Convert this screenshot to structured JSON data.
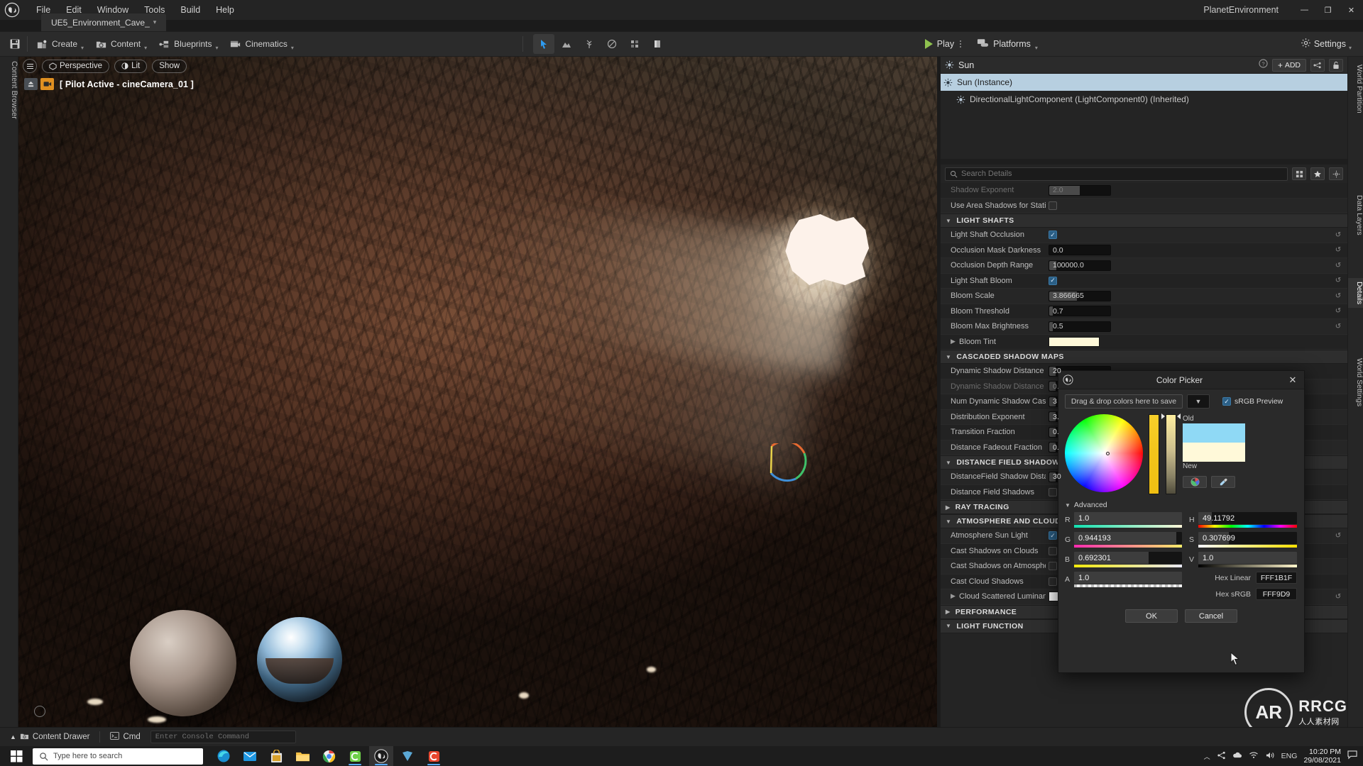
{
  "titlebar": {
    "logo_icon": "unreal-logo-icon",
    "menus": [
      "File",
      "Edit",
      "Window",
      "Tools",
      "Build",
      "Help"
    ],
    "project_name": "PlanetEnvironment",
    "window_buttons": [
      {
        "name": "minimize-button",
        "glyph": "—"
      },
      {
        "name": "maximize-button",
        "glyph": "❐"
      },
      {
        "name": "close-button",
        "glyph": "✕"
      }
    ]
  },
  "tabbar": {
    "document_tab": "UE5_Environment_Cave_",
    "modified_marker": "▾"
  },
  "toolbar": {
    "save_icon": "save-icon",
    "buttons": [
      {
        "label": "Create",
        "icon": "create-icon"
      },
      {
        "label": "Content",
        "icon": "content-icon"
      },
      {
        "label": "Blueprints",
        "icon": "blueprints-icon"
      },
      {
        "label": "Cinematics",
        "icon": "cinematics-icon"
      }
    ],
    "mode_icons": [
      "select-mode-icon",
      "landscape-mode-icon",
      "foliage-mode-icon",
      "mesh-paint-icon",
      "fracture-mode-icon",
      "brush-edit-icon"
    ],
    "play_label": "Play",
    "platforms_label": "Platforms",
    "settings_label": "Settings"
  },
  "viewport": {
    "hamburger_icon": "viewport-menu-icon",
    "camera_mode": "Perspective",
    "view_mode": "Lit",
    "show_label": "Show",
    "pilot_text": "[ Pilot Active - cineCamera_01 ]"
  },
  "left_strip": {
    "label": "Content Browser"
  },
  "outliner": {
    "title": "Sun",
    "help_icon": "help-icon",
    "add_label": "ADD",
    "settings_icon": "outliner-settings-icon",
    "lock_icon": "lock-icon",
    "rows": [
      {
        "label": "Sun (Instance)",
        "selected": true,
        "icon": "light-icon"
      },
      {
        "label": "DirectionalLightComponent (LightComponent0) (Inherited)",
        "selected": false,
        "icon": "light-icon"
      }
    ]
  },
  "details": {
    "search_placeholder": "Search Details",
    "grid_icon": "grid-view-icon",
    "star_icon": "favorites-icon",
    "gear_icon": "details-settings-icon",
    "rows": [
      {
        "type": "prop",
        "label": "Shadow Exponent",
        "value": "2.0",
        "control": "number",
        "fill": 0.5,
        "dim": true
      },
      {
        "type": "prop",
        "label": "Use Area Shadows for Stationary Lig",
        "control": "checkbox",
        "checked": false
      },
      {
        "type": "category",
        "label": "LIGHT SHAFTS",
        "expanded": true
      },
      {
        "type": "prop",
        "label": "Light Shaft Occlusion",
        "control": "checkbox",
        "checked": true,
        "reset": true
      },
      {
        "type": "prop",
        "label": "Occlusion Mask Darkness",
        "value": "0.0",
        "control": "number",
        "fill": 0.0,
        "reset": true
      },
      {
        "type": "prop",
        "label": "Occlusion Depth Range",
        "value": "100000.0",
        "control": "number",
        "fill": 0.12,
        "reset": true
      },
      {
        "type": "prop",
        "label": "Light Shaft Bloom",
        "control": "checkbox",
        "checked": true,
        "reset": true
      },
      {
        "type": "prop",
        "label": "Bloom Scale",
        "value": "3.866665",
        "control": "number",
        "fill": 0.45,
        "reset": true
      },
      {
        "type": "prop",
        "label": "Bloom Threshold",
        "value": "0.7",
        "control": "number",
        "fill": 0.06,
        "reset": true
      },
      {
        "type": "prop",
        "label": "Bloom Max Brightness",
        "value": "0.5",
        "control": "number",
        "fill": 0.06,
        "reset": true
      },
      {
        "type": "prop",
        "label": "Bloom Tint",
        "control": "swatch",
        "color": "#FFF9D9",
        "expandable": true
      },
      {
        "type": "category",
        "label": "CASCADED SHADOW MAPS",
        "expanded": true
      },
      {
        "type": "prop",
        "label": "Dynamic Shadow Distance Movable",
        "value": "20",
        "control": "number",
        "fill": 0.1
      },
      {
        "type": "prop",
        "label": "Dynamic Shadow Distance Stationar",
        "value": "0.",
        "control": "number",
        "fill": 0.1,
        "dim": true
      },
      {
        "type": "prop",
        "label": "Num Dynamic Shadow Cascades",
        "value": "3",
        "control": "number",
        "fill": 0.1
      },
      {
        "type": "prop",
        "label": "Distribution Exponent",
        "value": "3.",
        "control": "number",
        "fill": 0.1
      },
      {
        "type": "prop",
        "label": "Transition Fraction",
        "value": "0.",
        "control": "number",
        "fill": 0.1
      },
      {
        "type": "prop",
        "label": "Distance Fadeout Fraction",
        "value": "0.",
        "control": "number",
        "fill": 0.1
      },
      {
        "type": "category",
        "label": "DISTANCE FIELD SHADOWS",
        "expanded": true
      },
      {
        "type": "prop",
        "label": "DistanceField Shadow Distance",
        "value": "30",
        "control": "number",
        "fill": 0.1
      },
      {
        "type": "prop",
        "label": "Distance Field Shadows",
        "control": "checkbox",
        "checked": false
      },
      {
        "type": "category",
        "label": "RAY TRACING",
        "expanded": false
      },
      {
        "type": "category",
        "label": "ATMOSPHERE AND CLOUD",
        "expanded": true
      },
      {
        "type": "prop",
        "label": "Atmosphere Sun Light",
        "control": "checkbox",
        "checked": true,
        "reset": true
      },
      {
        "type": "prop",
        "label": "Cast Shadows on Clouds",
        "control": "checkbox",
        "checked": false
      },
      {
        "type": "prop",
        "label": "Cast Shadows on Atmosphere",
        "control": "checkbox",
        "checked": false
      },
      {
        "type": "prop",
        "label": "Cast Cloud Shadows",
        "control": "checkbox",
        "checked": false
      },
      {
        "type": "prop",
        "label": "Cloud Scattered Luminance Scale",
        "control": "swatch",
        "color": "#FFFFFF",
        "expandable": true,
        "reset": true
      },
      {
        "type": "category",
        "label": "PERFORMANCE",
        "expanded": false
      },
      {
        "type": "category",
        "label": "LIGHT FUNCTION",
        "expanded": true
      }
    ]
  },
  "right_tabs": [
    {
      "label": "World Partition",
      "active": false
    },
    {
      "label": "Data Layers",
      "active": false
    },
    {
      "label": "Details",
      "active": true
    },
    {
      "label": "World Settings",
      "active": false
    }
  ],
  "color_picker": {
    "title": "Color Picker",
    "logo_icon": "unreal-logo-icon",
    "close_icon": "close-icon",
    "dragdrop_label": "Drag & drop colors here to save",
    "dropdown_icon": "chevron-down-icon",
    "srgb_label": "sRGB Preview",
    "srgb_checked": true,
    "old_label": "Old",
    "new_label": "New",
    "old_color": "#8FD9F5",
    "new_color": "#FFF9D9",
    "wheel_icon": "color-wheel-icon",
    "eyedropper_icon": "eyedropper-icon",
    "advanced_label": "Advanced",
    "rgba": [
      {
        "key": "R",
        "value": "1.0",
        "fill": 1.0,
        "gradient": "linear-gradient(90deg,#11e0b0,#fdf6d8)"
      },
      {
        "key": "G",
        "value": "0.944193",
        "fill": 0.944,
        "gradient": "linear-gradient(90deg,#ff2bb0,#f6ec6a)"
      },
      {
        "key": "B",
        "value": "0.692301",
        "fill": 0.692,
        "gradient": "linear-gradient(90deg,#f2e90c,#e8e8f5)"
      },
      {
        "key": "A",
        "value": "1.0",
        "fill": 1.0,
        "gradient": "repeating-linear-gradient(90deg,#bdbdbd 0 4px,#f2f2f2 4px 8px)"
      }
    ],
    "hsv": [
      {
        "key": "H",
        "value": "49.11792",
        "fill": 0.135,
        "gradient": "linear-gradient(90deg,#ff0000,#ffff00,#00ff00,#00ffff,#0000ff,#ff00ff,#ff0000)"
      },
      {
        "key": "S",
        "value": "0.307699",
        "fill": 0.307,
        "gradient": "linear-gradient(90deg,#ffffff,#ffe000)"
      },
      {
        "key": "V",
        "value": "1.0",
        "fill": 1.0,
        "gradient": "linear-gradient(90deg,#000000,#fff6cc)"
      }
    ],
    "hex_linear_label": "Hex Linear",
    "hex_linear_value": "FFF1B1F",
    "hex_srgb_label": "Hex sRGB",
    "hex_srgb_value": "FFF9D9",
    "ok_label": "OK",
    "cancel_label": "Cancel"
  },
  "statusbar": {
    "chevron_icon": "chevron-up-icon",
    "content_drawer_label": "Content Drawer",
    "content_drawer_icon": "drawer-icon",
    "cmd_label": "Cmd",
    "cmd_icon": "console-icon",
    "cmd_placeholder": "Enter Console Command"
  },
  "taskbar": {
    "start_icon": "windows-start-icon",
    "search_placeholder": "Type here to search",
    "search_icon": "search-icon",
    "apps": [
      {
        "name": "edge-icon",
        "active": false
      },
      {
        "name": "mail-icon",
        "active": false
      },
      {
        "name": "store-icon",
        "active": false
      },
      {
        "name": "file-explorer-icon",
        "active": false
      },
      {
        "name": "chrome-icon",
        "active": false
      },
      {
        "name": "capcut-icon",
        "active": false
      },
      {
        "name": "unreal-engine-icon",
        "active": true
      },
      {
        "name": "photoshop-icon",
        "active": false
      },
      {
        "name": "adobe-icon",
        "active": false
      }
    ],
    "tray_icons": [
      "tray-expand-icon",
      "network-share-icon",
      "onedrive-icon",
      "wifi-icon",
      "volume-icon"
    ],
    "language": "ENG",
    "time": "10:20 PM",
    "date": "29/08/2021",
    "notification_icon": "notification-icon"
  },
  "watermark": {
    "line1": "RRCG",
    "line2": "人人素材网",
    "logo": "AR"
  }
}
